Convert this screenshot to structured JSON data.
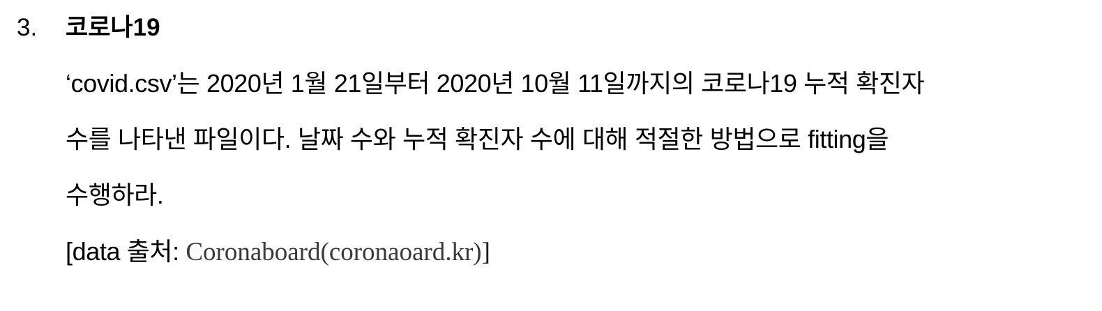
{
  "problem": {
    "number": "3.",
    "title": "코로나19",
    "lines": [
      "‘covid.csv’는 2020년 1월 21일부터 2020년 10월 11일까지의 코로나19 누적 확진자",
      "수를 나타낸 파일이다. 날짜 수와 누적 확진자 수에 대해 적절한 방법으로 fitting을",
      "수행하라."
    ],
    "source": {
      "prefix": "[data 출처: ",
      "name": "Coronaboard(coronaoard.kr)",
      "suffix": "]"
    }
  }
}
